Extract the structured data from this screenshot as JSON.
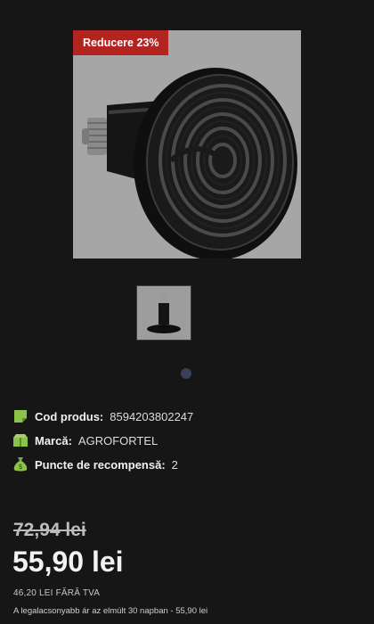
{
  "badge": {
    "discount_label": "Reducere 23%"
  },
  "product": {
    "image_icon": "ceramic-heat-emitter-lamp",
    "thumbnail_icon": "ceramic-heat-emitter-thumbnail"
  },
  "pager": {
    "dots": 1,
    "active": 1
  },
  "meta": {
    "code": {
      "label": "Cod produs:",
      "value": "8594203802247",
      "icon": "barcode-tag-icon"
    },
    "brand": {
      "label": "Marcă:",
      "value": "AGROFORTEL",
      "icon": "box-icon"
    },
    "points": {
      "label": "Puncte de recompensă:",
      "value": "2",
      "icon": "money-bag-icon"
    }
  },
  "pricing": {
    "old_price": "72,94 lei",
    "new_price": "55,90 lei",
    "price_without_vat": "46,20 LEI FĂRĂ TVA",
    "lowest_price_note": "A legalacsonyabb ár az elmúlt 30 napban - 55,90 lei"
  },
  "colors": {
    "badge_bg": "#b3231f",
    "background": "#161616",
    "accent_green": "#8bc34a"
  }
}
